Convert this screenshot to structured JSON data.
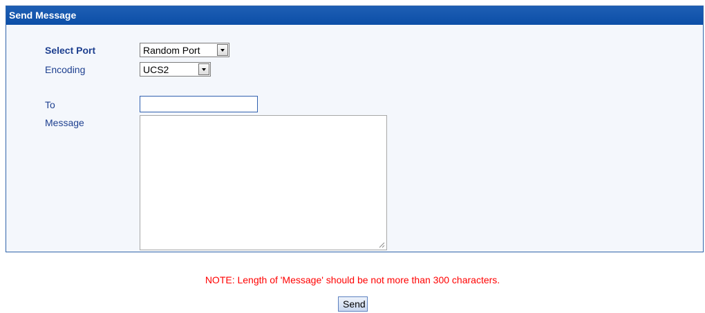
{
  "panel": {
    "title": "Send Message"
  },
  "form": {
    "select_port": {
      "label": "Select Port",
      "value": "Random Port"
    },
    "encoding": {
      "label": "Encoding",
      "value": "UCS2"
    },
    "to": {
      "label": "To",
      "value": ""
    },
    "message": {
      "label": "Message",
      "value": ""
    }
  },
  "note": "NOTE: Length of 'Message' should be not more than 300 characters.",
  "actions": {
    "send_label": "Send"
  },
  "colors": {
    "header_bg": "#0c4ea7",
    "label_text": "#1d3f8f",
    "note_text": "#ff0000",
    "panel_bg": "#f4f7fc"
  }
}
